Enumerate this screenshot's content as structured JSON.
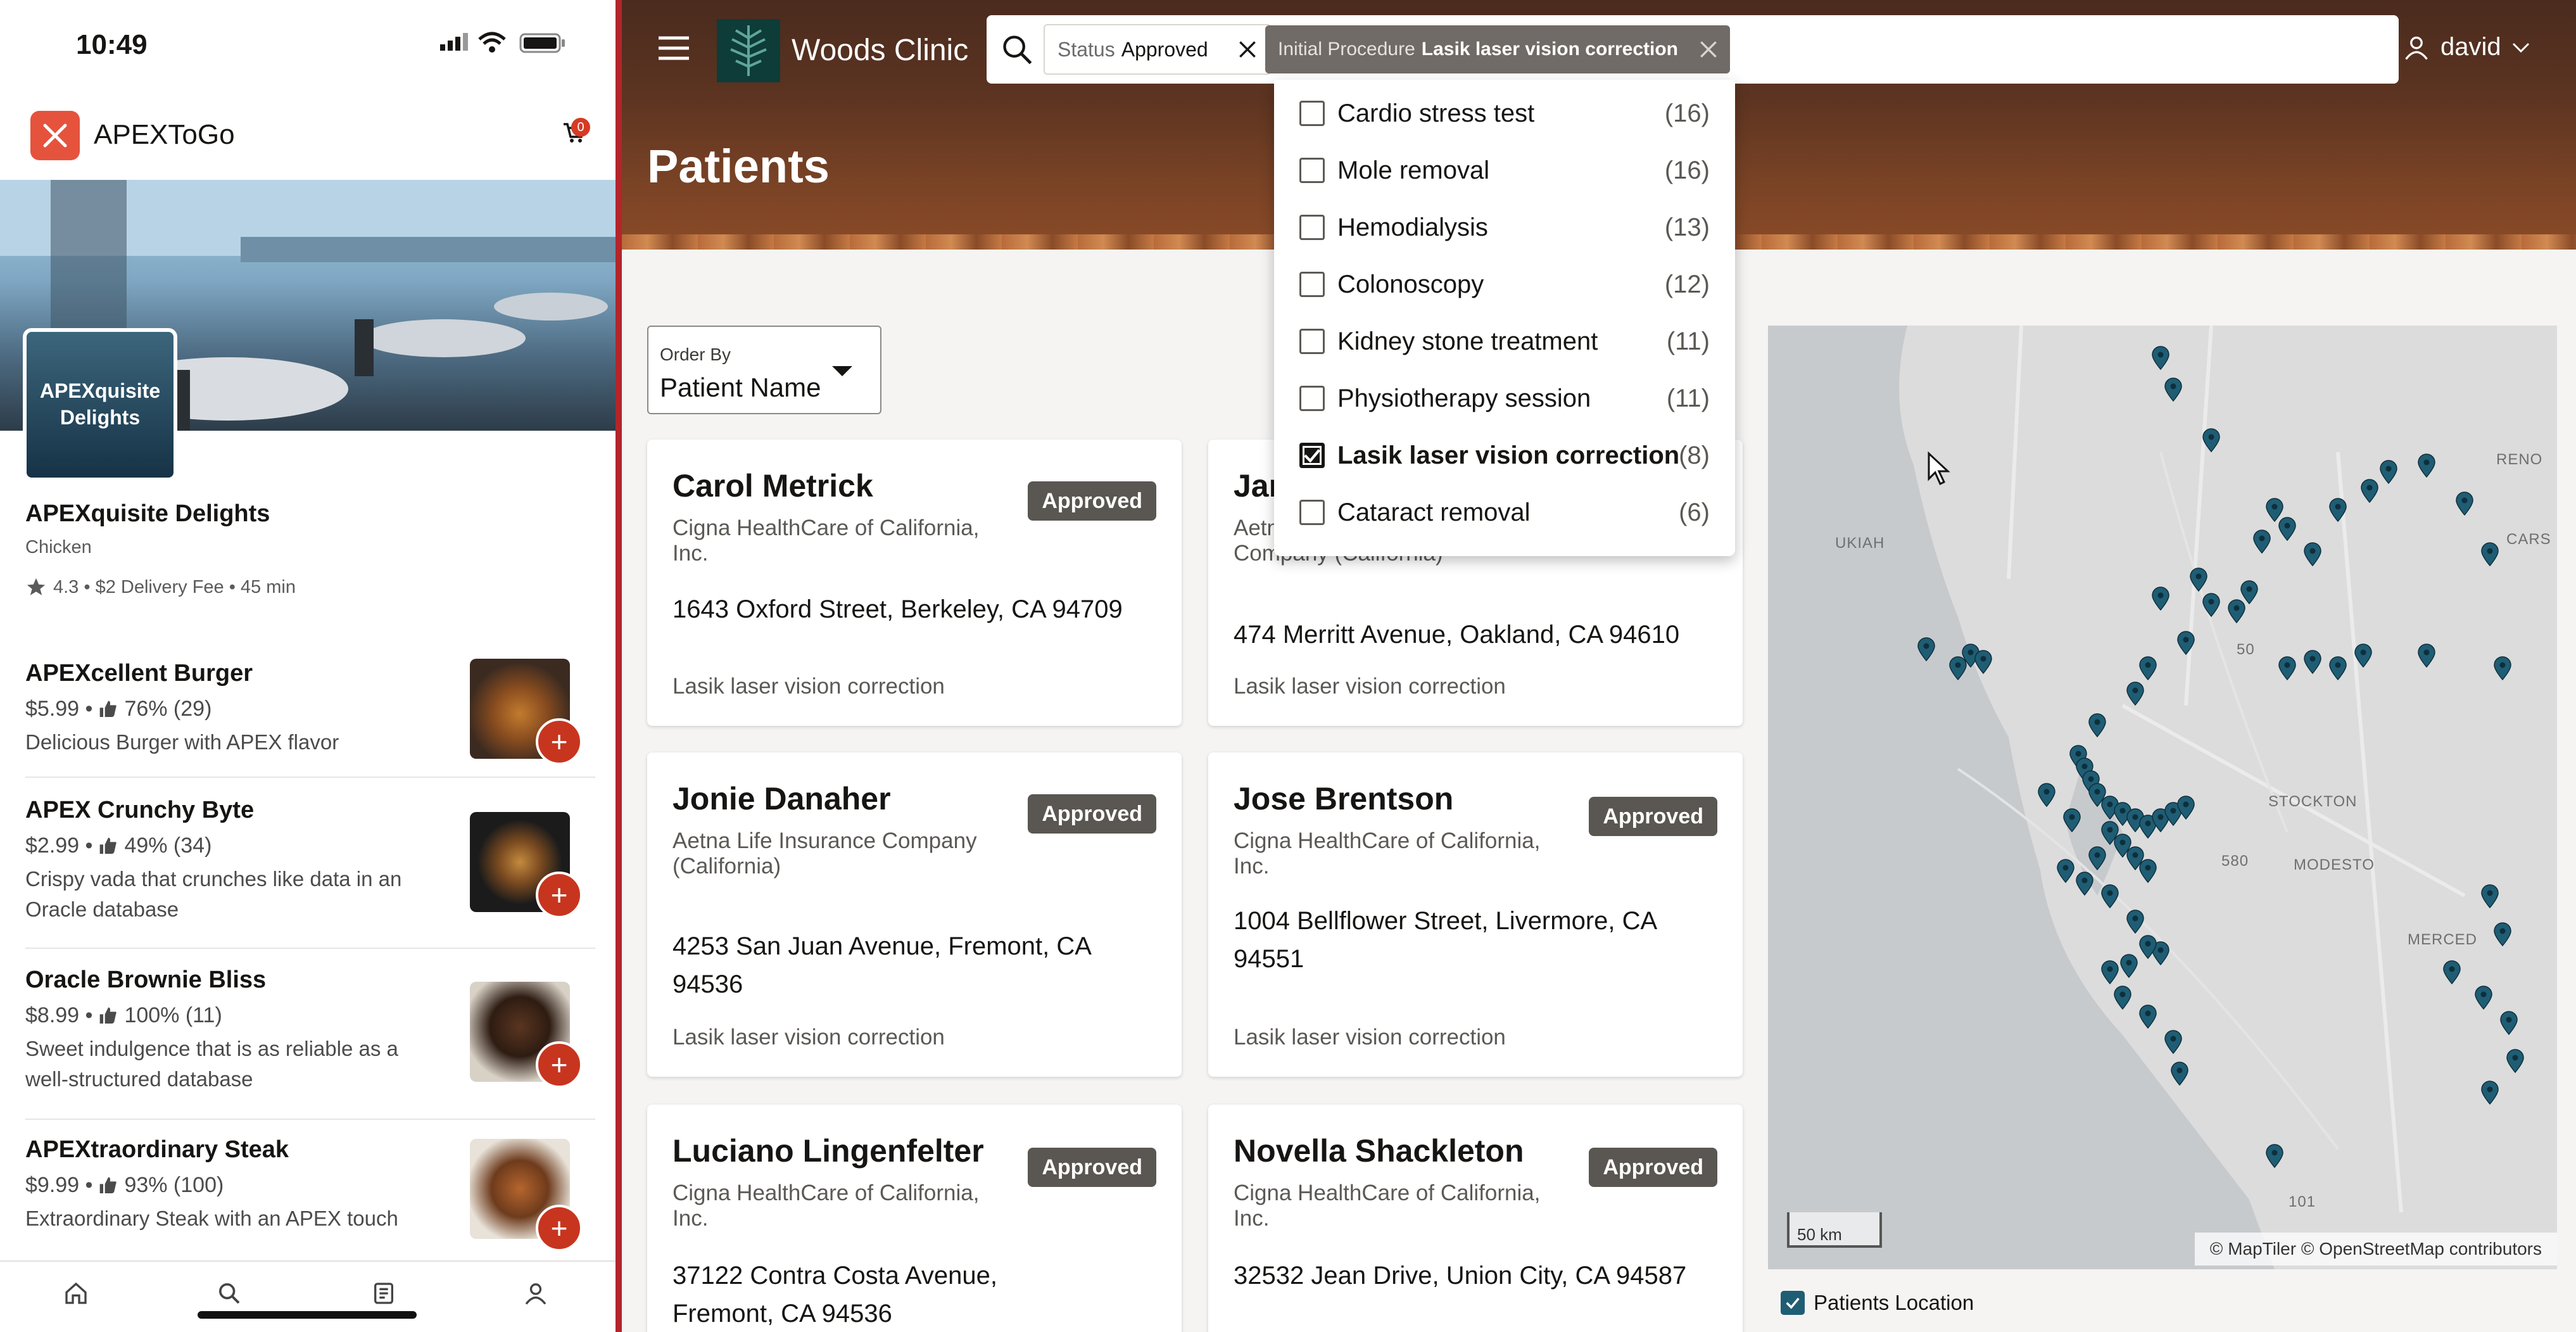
{
  "phone": {
    "status_time": "10:49",
    "app_name": "APEXToGo",
    "cart_count": "0",
    "restaurant": {
      "logo_text": "APEXquisite Delights",
      "name": "APEXquisite Delights",
      "category": "Chicken",
      "meta": "4.3 • $2 Delivery Fee • 45 min"
    },
    "menu_items": [
      {
        "name": "APEXcellent Burger",
        "price": "$5.99 •",
        "rating": "76% (29)",
        "desc": "Delicious Burger with APEX flavor"
      },
      {
        "name": "APEX Crunchy Byte",
        "price": "$2.99 •",
        "rating": "49% (34)",
        "desc": "Crispy vada that crunches like data in an Oracle database"
      },
      {
        "name": "Oracle Brownie Bliss",
        "price": "$8.99 •",
        "rating": "100% (11)",
        "desc": "Sweet indulgence that is as reliable as a well-structured database"
      },
      {
        "name": "APEXtraordinary Steak",
        "price": "$9.99 •",
        "rating": "93% (100)",
        "desc": "Extraordinary Steak with an APEX touch"
      }
    ],
    "tabs": [
      "home-icon",
      "search-icon",
      "orders-icon",
      "profile-icon"
    ]
  },
  "clinic": {
    "app_name": "Woods Clinic",
    "user": "david",
    "page_title": "Patients",
    "search": {
      "chip1_label": "Status",
      "chip1_value": "Approved",
      "chip2_label": "Initial Procedure",
      "chip2_value": "Lasik laser vision correction"
    },
    "order_by": {
      "label": "Order By",
      "value": "Patient Name"
    },
    "patients": [
      {
        "name": "Carol Metrick",
        "status": "Approved",
        "insurance": "Cigna HealthCare of California, Inc.",
        "address": "1643 Oxford Street, Berkeley, CA 94709",
        "procedure": "Lasik laser vision correction"
      },
      {
        "name": "Jan",
        "status": "",
        "insurance": "Aetna Life Insurance Company (California)",
        "address": "474 Merritt Avenue, Oakland, CA 94610",
        "procedure": "Lasik laser vision correction"
      },
      {
        "name": "Jonie Danaher",
        "status": "Approved",
        "insurance": "Aetna Life Insurance Company (California)",
        "address": "4253 San Juan Avenue, Fremont, CA 94536",
        "procedure": "Lasik laser vision correction"
      },
      {
        "name": "Jose Brentson",
        "status": "Approved",
        "insurance": "Cigna HealthCare of California, Inc.",
        "address": "1004 Bellflower Street, Livermore, CA 94551",
        "procedure": "Lasik laser vision correction"
      },
      {
        "name": "Luciano Lingenfelter",
        "status": "Approved",
        "insurance": "Cigna HealthCare of California, Inc.",
        "address": "37122 Contra Costa Avenue, Fremont, CA 94536",
        "procedure": ""
      },
      {
        "name": "Novella Shackleton",
        "status": "Approved",
        "insurance": "Cigna HealthCare of California, Inc.",
        "address": "32532 Jean Drive, Union City, CA 94587",
        "procedure": ""
      }
    ],
    "procedure_filter": [
      {
        "label": "Cardio stress test",
        "count": "(16)",
        "checked": false
      },
      {
        "label": "Mole removal",
        "count": "(16)",
        "checked": false
      },
      {
        "label": "Hemodialysis",
        "count": "(13)",
        "checked": false
      },
      {
        "label": "Colonoscopy",
        "count": "(12)",
        "checked": false
      },
      {
        "label": "Kidney stone treatment",
        "count": "(11)",
        "checked": false
      },
      {
        "label": "Physiotherapy session",
        "count": "(11)",
        "checked": false
      },
      {
        "label": "Lasik laser vision correction",
        "count": "(8)",
        "checked": true
      },
      {
        "label": "Cataract removal",
        "count": "(6)",
        "checked": false
      }
    ],
    "map": {
      "towns": [
        "RENO",
        "UKIAH",
        "CARS",
        "STOCKTON",
        "MODESTO",
        "MERCED",
        "50",
        "580",
        "101"
      ],
      "scale": "50 km",
      "attribution": "© MapTiler  © OpenStreetMap contributors",
      "legend": "Patients Location"
    },
    "colors": {
      "accent": "#1f5d74",
      "badge": "#5a5651",
      "divider": "#b3252b"
    }
  }
}
